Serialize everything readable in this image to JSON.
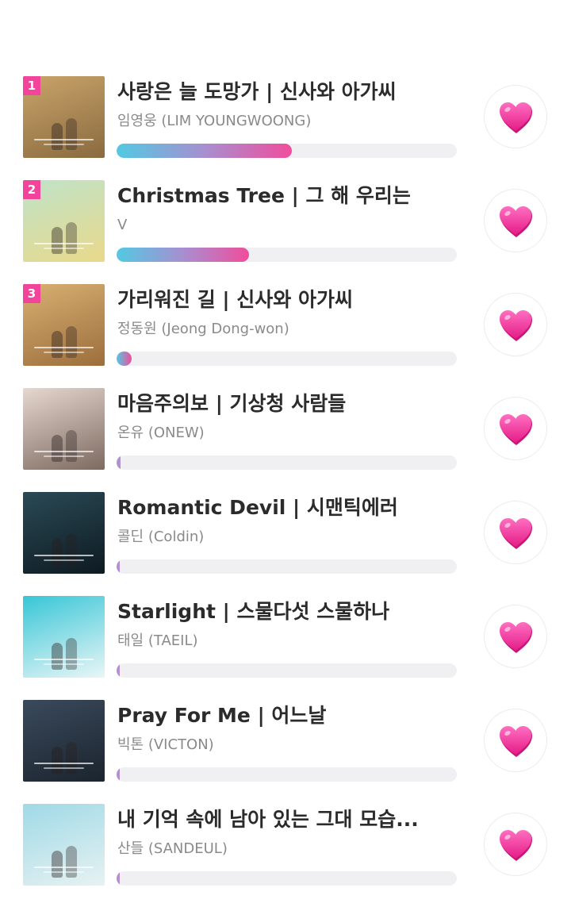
{
  "songs": [
    {
      "rank": "1",
      "title": "사랑은 늘 도망가 | 신사와 아가씨",
      "artist": "임영웅 (LIM YOUNGWOONG)",
      "vote_share": 0.515,
      "cover_colors": [
        "#c9a46a",
        "#8a6a3f"
      ]
    },
    {
      "rank": "2",
      "title": "Christmas Tree | 그 해 우리는",
      "artist": "V",
      "vote_share": 0.39,
      "cover_colors": [
        "#bfe3c9",
        "#e9d98a"
      ]
    },
    {
      "rank": "3",
      "title": "가리워진 길 | 신사와 아가씨",
      "artist": "정동원 (Jeong Dong-won)",
      "vote_share": 0.045,
      "cover_colors": [
        "#d8b072",
        "#9c6e3c"
      ]
    },
    {
      "rank": "",
      "title": "마음주의보 | 기상청 사람들",
      "artist": "온유 (ONEW)",
      "vote_share": 0.012,
      "cover_colors": [
        "#e6d7cf",
        "#7d6a60"
      ]
    },
    {
      "rank": "",
      "title": "Romantic Devil | 시맨틱에러",
      "artist": "콜딘 (Coldin)",
      "vote_share": 0.01,
      "cover_colors": [
        "#2a4a55",
        "#0e1a22"
      ]
    },
    {
      "rank": "",
      "title": "Starlight | 스물다섯 스물하나",
      "artist": "태일 (TAEIL)",
      "vote_share": 0.008,
      "cover_colors": [
        "#38c6d6",
        "#e9f6f7"
      ]
    },
    {
      "rank": "",
      "title": "Pray For Me | 어느날",
      "artist": "빅톤 (VICTON)",
      "vote_share": 0.006,
      "cover_colors": [
        "#3a4a5c",
        "#1b242e"
      ]
    },
    {
      "rank": "",
      "title": "내 기억 속에 남아 있는 그대 모습...",
      "artist": "산들 (SANDEUL)",
      "vote_share": 0.006,
      "cover_colors": [
        "#9fd9e6",
        "#e7f2f2"
      ]
    }
  ],
  "accent": "#f2449a",
  "heart_icon": "heart-icon"
}
